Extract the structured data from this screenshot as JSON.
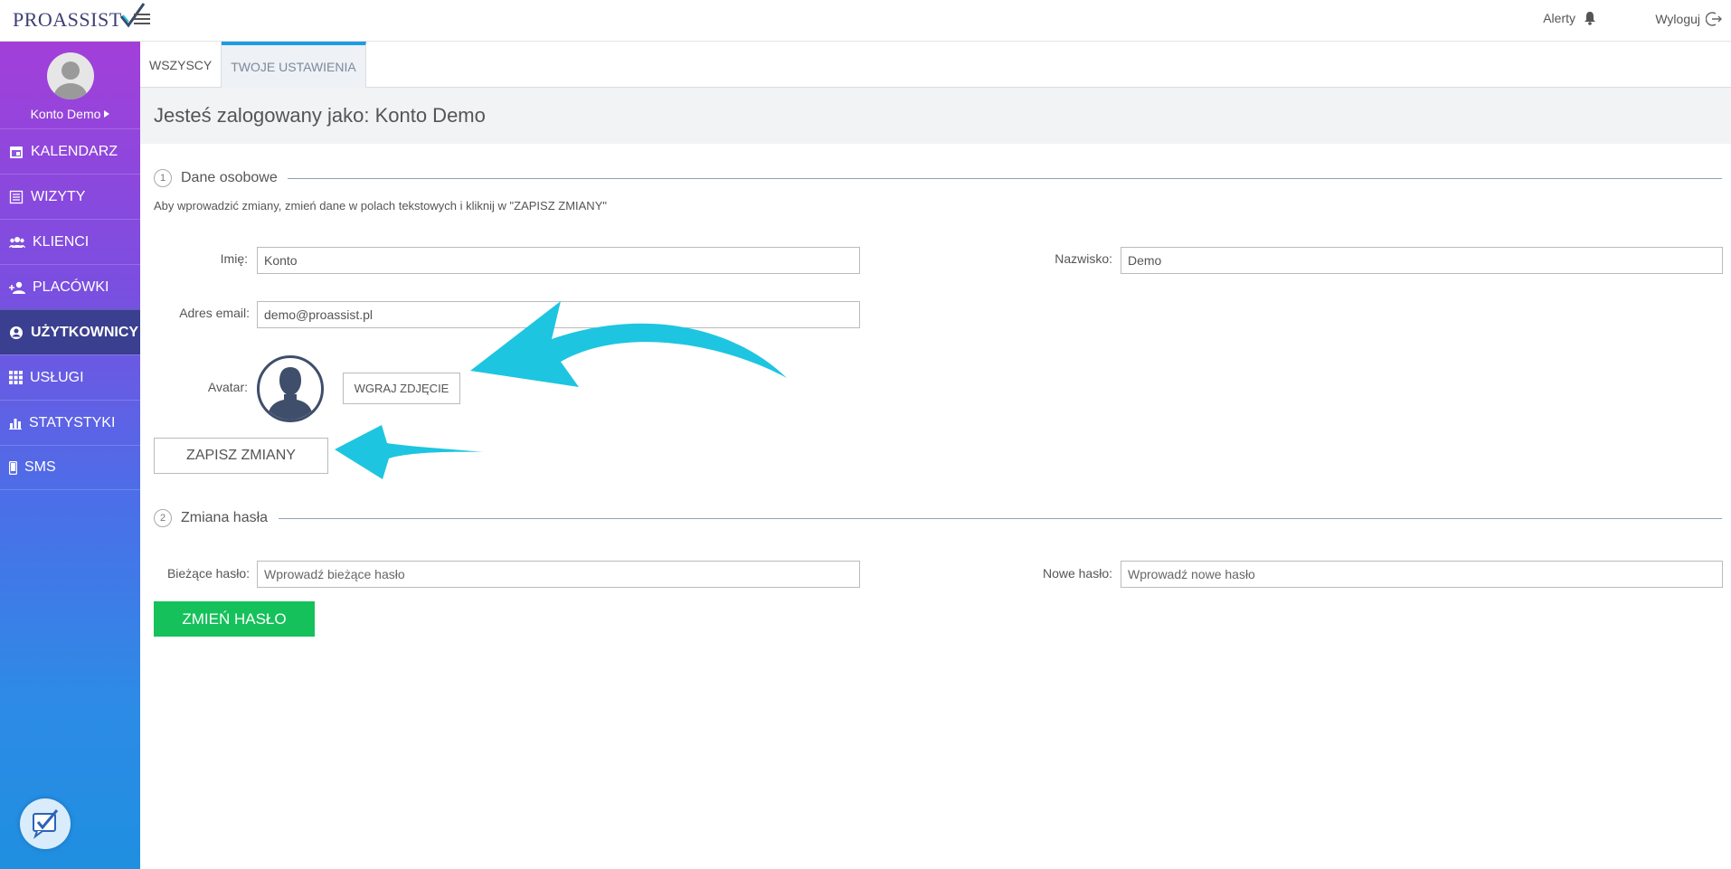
{
  "topbar": {
    "logo_text": "PROASSIST",
    "alerts_label": "Alerty",
    "logout_label": "Wyloguj"
  },
  "sidebar": {
    "user_name": "Konto Demo",
    "items": [
      {
        "label": "KALENDARZ",
        "icon": "calendar-icon"
      },
      {
        "label": "WIZYTY",
        "icon": "list-icon"
      },
      {
        "label": "KLIENCI",
        "icon": "people-icon"
      },
      {
        "label": "PLACÓWKI",
        "icon": "person-add-icon"
      },
      {
        "label": "UŻYTKOWNICY",
        "icon": "user-circle-icon",
        "active": true
      },
      {
        "label": "USŁUGI",
        "icon": "grid-icon"
      },
      {
        "label": "STATYSTYKI",
        "icon": "bar-chart-icon"
      },
      {
        "label": "SMS",
        "icon": "phone-icon"
      }
    ]
  },
  "tabs": [
    {
      "label": "WSZYSCY"
    },
    {
      "label": "TWOJE USTAWIENIA",
      "selected": true
    }
  ],
  "heading": "Jesteś zalogowany jako: Konto Demo",
  "section1": {
    "number": "1",
    "title": "Dane osobowe",
    "hint": "Aby wprowadzić zmiany, zmień dane w polach tekstowych i kliknij w \"ZAPISZ ZMIANY\"",
    "first_name_label": "Imię:",
    "first_name_value": "Konto",
    "last_name_label": "Nazwisko:",
    "last_name_value": "Demo",
    "email_label": "Adres email:",
    "email_value": "demo@proassist.pl",
    "avatar_label": "Avatar:",
    "upload_button": "WGRAJ ZDJĘCIE",
    "save_button": "ZAPISZ ZMIANY"
  },
  "section2": {
    "number": "2",
    "title": "Zmiana hasła",
    "current_label": "Bieżące hasło:",
    "current_placeholder": "Wprowadź bieżące hasło",
    "new_label": "Nowe hasło:",
    "new_placeholder": "Wprowadź nowe hasło",
    "change_button": "ZMIEŃ HASŁO"
  },
  "colors": {
    "accent": "#1e9be6",
    "green": "#15c15a",
    "active_nav": "#3a3f8f",
    "arrow": "#1ec5e0"
  }
}
